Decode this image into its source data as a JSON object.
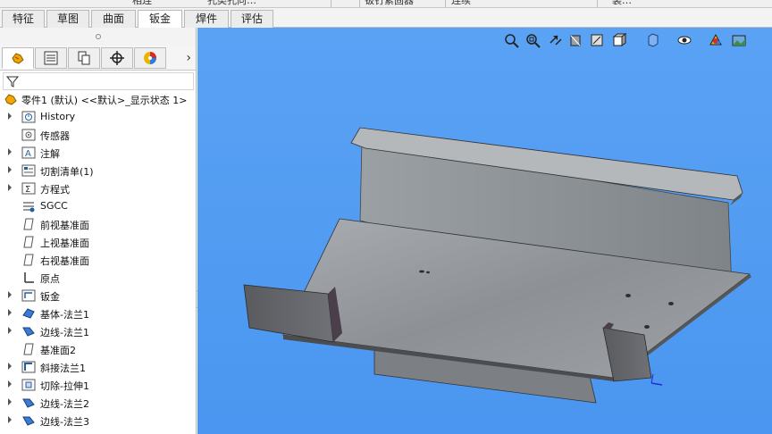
{
  "ribbon": {
    "items": [
      "相连",
      "孔类孔向…",
      "钣钉紧固器",
      "连续",
      "装…"
    ]
  },
  "command_tabs": [
    {
      "label": "特征",
      "active": false
    },
    {
      "label": "草图",
      "active": false
    },
    {
      "label": "曲面",
      "active": false
    },
    {
      "label": "钣金",
      "active": true
    },
    {
      "label": "焊件",
      "active": false
    },
    {
      "label": "评估",
      "active": false
    }
  ],
  "panel": {
    "tabs": [
      "feature-manager",
      "property-manager",
      "configuration-manager",
      "dim-xpert-manager",
      "display-manager"
    ],
    "root": "零件1 (默认) <<默认>_显示状态 1>",
    "tree": [
      {
        "label": "History",
        "icon": "history-icon",
        "expandable": true
      },
      {
        "label": "传感器",
        "icon": "sensor-icon",
        "expandable": false
      },
      {
        "label": "注解",
        "icon": "annotation-icon",
        "expandable": true
      },
      {
        "label": "切割清单(1)",
        "icon": "cut-list-icon",
        "expandable": true
      },
      {
        "label": "方程式",
        "icon": "equation-icon",
        "expandable": true
      },
      {
        "label": "SGCC",
        "icon": "material-icon",
        "expandable": false
      },
      {
        "label": "前视基准面",
        "icon": "plane-icon",
        "expandable": false
      },
      {
        "label": "上视基准面",
        "icon": "plane-icon",
        "expandable": false
      },
      {
        "label": "右视基准面",
        "icon": "plane-icon",
        "expandable": false
      },
      {
        "label": "原点",
        "icon": "origin-icon",
        "expandable": false
      },
      {
        "label": "钣金",
        "icon": "sheet-metal-icon",
        "expandable": true
      },
      {
        "label": "基体-法兰1",
        "icon": "base-flange-icon",
        "expandable": true
      },
      {
        "label": "边线-法兰1",
        "icon": "edge-flange-icon",
        "expandable": true
      },
      {
        "label": "基准面2",
        "icon": "plane-icon",
        "expandable": false
      },
      {
        "label": "斜接法兰1",
        "icon": "miter-flange-icon",
        "expandable": true
      },
      {
        "label": "切除-拉伸1",
        "icon": "cut-extrude-icon",
        "expandable": true
      },
      {
        "label": "边线-法兰2",
        "icon": "edge-flange-icon",
        "expandable": true
      },
      {
        "label": "边线-法兰3",
        "icon": "edge-flange-icon",
        "expandable": true
      }
    ]
  },
  "viewport": {
    "background": "#4f9af2",
    "hud_icons": [
      "zoom-to-fit-icon",
      "zoom-area-icon",
      "previous-view-icon",
      "section-view-icon",
      "dynamic-annotation-icon",
      "view-orientation-icon",
      "display-style-icon",
      "hide-show-icon",
      "edit-appearance-icon",
      "apply-scene-icon"
    ]
  },
  "colors": {
    "accent_tab": "#ffffff",
    "tree_icon_blue": "#1f5fa8",
    "sheet_metal": "#9aa0a6"
  }
}
